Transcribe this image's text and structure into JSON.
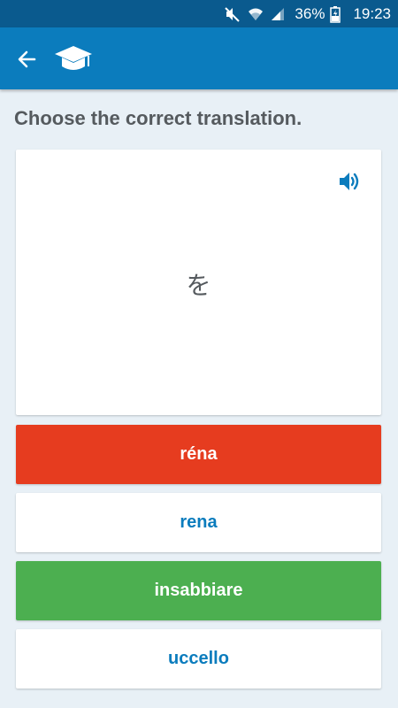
{
  "status_bar": {
    "battery": "36%",
    "time": "19:23",
    "icons": [
      "mute-icon",
      "wifi-icon",
      "signal-icon",
      "battery-icon"
    ]
  },
  "app_bar": {
    "icons": [
      "back-arrow-icon",
      "graduation-cap-icon"
    ],
    "color": "#0b7cbd"
  },
  "quiz": {
    "prompt": "Choose the correct translation.",
    "word": "を",
    "speaker_icon": "speaker-icon",
    "options": [
      {
        "label": "réna",
        "state": "wrong",
        "bg": "#e63c1f",
        "fg": "#ffffff"
      },
      {
        "label": "rena",
        "state": "neutral",
        "bg": "#ffffff",
        "fg": "#0b7cbd"
      },
      {
        "label": "insabbiare",
        "state": "correct",
        "bg": "#4caf50",
        "fg": "#ffffff"
      },
      {
        "label": "uccello",
        "state": "neutral",
        "bg": "#ffffff",
        "fg": "#0b7cbd"
      }
    ]
  }
}
